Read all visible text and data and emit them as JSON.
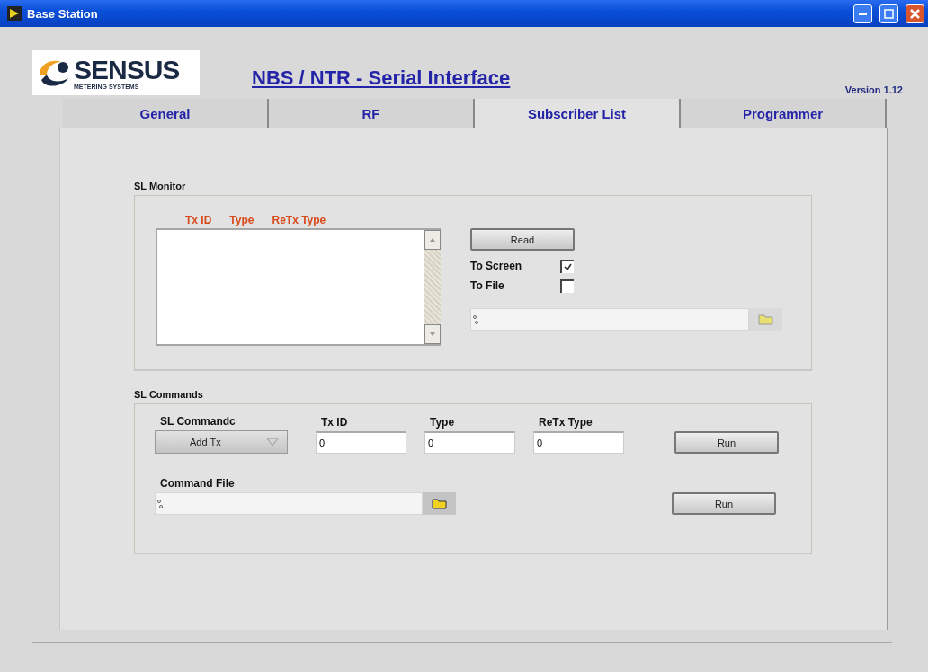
{
  "window": {
    "title": "Base Station"
  },
  "logo": {
    "name": "SENSUS",
    "tagline": "METERING SYSTEMS"
  },
  "heading": "NBS / NTR - Serial Interface",
  "version": "Version 1.12",
  "tabs": [
    {
      "label": "General",
      "selected": false
    },
    {
      "label": "RF",
      "selected": false
    },
    {
      "label": "Subscriber List",
      "selected": true
    },
    {
      "label": "Programmer",
      "selected": false
    }
  ],
  "monitor": {
    "title": "SL Monitor",
    "columns": [
      "Tx ID",
      "Type",
      "ReTx Type"
    ],
    "read_button": "Read",
    "outputs": [
      {
        "label": "To Screen",
        "checked": true
      },
      {
        "label": "To File",
        "checked": false
      }
    ]
  },
  "commands": {
    "title": "SL Commands",
    "selector": {
      "label": "SL Commandc",
      "value": "Add Tx"
    },
    "fields": [
      {
        "label": "Tx ID",
        "value": "0"
      },
      {
        "label": "Type",
        "value": "0"
      },
      {
        "label": "ReTx Type",
        "value": "0"
      }
    ],
    "run_button": "Run",
    "file_label": "Command File",
    "file_run_button": "Run"
  }
}
